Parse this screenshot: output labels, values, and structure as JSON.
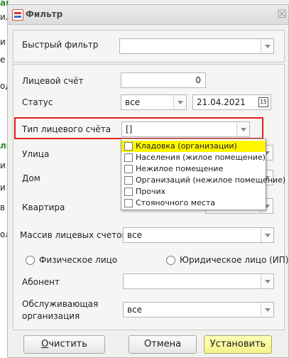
{
  "background": {
    "fragments": [
      {
        "text": "ам",
        "green": true
      },
      {
        "text": "ил",
        "green": false
      },
      {
        "text": "и",
        "green": false
      },
      {
        "text": "е",
        "green": false
      },
      {
        "text": "од",
        "green": false
      },
      {
        "text": "ли",
        "green": true
      },
      {
        "text": "и",
        "green": false
      },
      {
        "text": "и",
        "green": false
      },
      {
        "text": "в",
        "green": false
      },
      {
        "text": "ол",
        "green": false
      }
    ]
  },
  "window": {
    "title": "Фильтр",
    "close_glyph": "☒"
  },
  "quick_filter": {
    "label": "Быстрый фильтр",
    "value": ""
  },
  "account": {
    "label": "Лицевой счёт",
    "value": "0"
  },
  "status": {
    "label": "Статус",
    "value": "все",
    "date": "21.04.2021",
    "calendar_glyph": "15"
  },
  "account_type": {
    "label": "Тип лицевого счёта",
    "value": "[]",
    "options": [
      {
        "label": "Кладовка (организации)",
        "selected": true
      },
      {
        "label": "Населения (жилое помещение)",
        "selected": false
      },
      {
        "label": "Нежилое помещение",
        "selected": false
      },
      {
        "label": "Организаций (нежилое помещение)",
        "selected": false
      },
      {
        "label": "Прочих",
        "selected": false
      },
      {
        "label": "Стояночного места",
        "selected": false
      }
    ]
  },
  "street": {
    "label": "Улица",
    "value": ""
  },
  "house": {
    "label": "Дом",
    "value": ""
  },
  "apartment": {
    "label": "Квартира",
    "value": ""
  },
  "accounts_array": {
    "label": "Массив лицевых счетов",
    "value": "все"
  },
  "person_type": {
    "physical": "Физическое лицо",
    "legal": "Юридическое лицо (ИП)"
  },
  "subscriber": {
    "label": "Абонент",
    "value": ""
  },
  "org": {
    "label_line1": "Обслуживающая",
    "label_line2": "организация",
    "value": "все"
  },
  "buttons": {
    "clear_first": "О",
    "clear_rest": "чистить",
    "cancel": "Отмена",
    "apply": "Установить"
  },
  "colors": {
    "highlight": "#e02020",
    "selected_option": "#fff700",
    "primary_button": "#f4f48a"
  }
}
